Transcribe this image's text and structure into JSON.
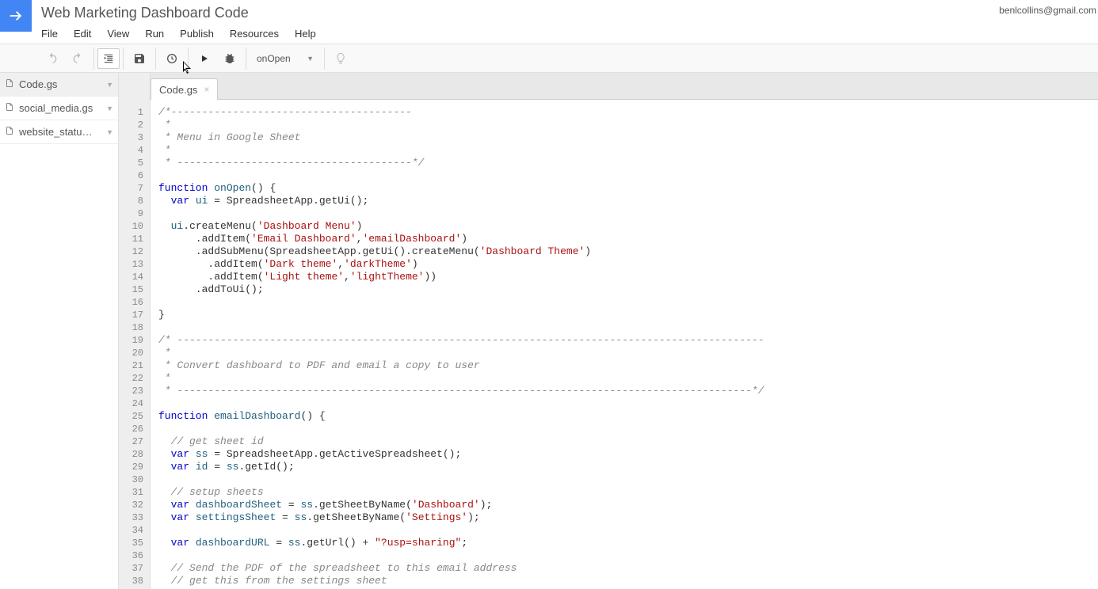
{
  "header": {
    "title": "Web Marketing Dashboard Code",
    "user_email": "benlcollins@gmail.com",
    "menus": [
      "File",
      "Edit",
      "View",
      "Run",
      "Publish",
      "Resources",
      "Help"
    ]
  },
  "toolbar": {
    "function_selected": "onOpen"
  },
  "sidebar": {
    "files": [
      {
        "name": "Code.gs",
        "active": true
      },
      {
        "name": "social_media.gs",
        "active": false
      },
      {
        "name": "website_statu…",
        "active": false
      }
    ]
  },
  "tabs": [
    {
      "label": "Code.gs",
      "active": true
    }
  ],
  "code": {
    "lines": [
      {
        "n": 1,
        "t": [
          [
            "comment",
            "/*---------------------------------------"
          ]
        ]
      },
      {
        "n": 2,
        "t": [
          [
            "comment",
            " *"
          ]
        ]
      },
      {
        "n": 3,
        "t": [
          [
            "comment",
            " * Menu in Google Sheet"
          ]
        ]
      },
      {
        "n": 4,
        "t": [
          [
            "comment",
            " *"
          ]
        ]
      },
      {
        "n": 5,
        "t": [
          [
            "comment",
            " * --------------------------------------*/"
          ]
        ]
      },
      {
        "n": 6,
        "t": []
      },
      {
        "n": 7,
        "t": [
          [
            "kw",
            "function"
          ],
          [
            "plain",
            " "
          ],
          [
            "name",
            "onOpen"
          ],
          [
            "plain",
            "() {"
          ]
        ]
      },
      {
        "n": 8,
        "t": [
          [
            "plain",
            "  "
          ],
          [
            "kw",
            "var"
          ],
          [
            "plain",
            " "
          ],
          [
            "prop",
            "ui"
          ],
          [
            "plain",
            " = SpreadsheetApp.getUi();"
          ]
        ]
      },
      {
        "n": 9,
        "t": []
      },
      {
        "n": 10,
        "t": [
          [
            "plain",
            "  "
          ],
          [
            "prop",
            "ui"
          ],
          [
            "plain",
            ".createMenu("
          ],
          [
            "str",
            "'Dashboard Menu'"
          ],
          [
            "plain",
            ")"
          ]
        ]
      },
      {
        "n": 11,
        "t": [
          [
            "plain",
            "      .addItem("
          ],
          [
            "str",
            "'Email Dashboard'"
          ],
          [
            "plain",
            ","
          ],
          [
            "str",
            "'emailDashboard'"
          ],
          [
            "plain",
            ")"
          ]
        ]
      },
      {
        "n": 12,
        "t": [
          [
            "plain",
            "      .addSubMenu(SpreadsheetApp.getUi().createMenu("
          ],
          [
            "str",
            "'Dashboard Theme'"
          ],
          [
            "plain",
            ")"
          ]
        ]
      },
      {
        "n": 13,
        "t": [
          [
            "plain",
            "        .addItem("
          ],
          [
            "str",
            "'Dark theme'"
          ],
          [
            "plain",
            ","
          ],
          [
            "str",
            "'darkTheme'"
          ],
          [
            "plain",
            ")"
          ]
        ]
      },
      {
        "n": 14,
        "t": [
          [
            "plain",
            "        .addItem("
          ],
          [
            "str",
            "'Light theme'"
          ],
          [
            "plain",
            ","
          ],
          [
            "str",
            "'lightTheme'"
          ],
          [
            "plain",
            "))"
          ]
        ]
      },
      {
        "n": 15,
        "t": [
          [
            "plain",
            "      .addToUi();"
          ]
        ]
      },
      {
        "n": 16,
        "t": []
      },
      {
        "n": 17,
        "t": [
          [
            "plain",
            "}"
          ]
        ]
      },
      {
        "n": 18,
        "t": []
      },
      {
        "n": 19,
        "t": [
          [
            "comment",
            "/* -----------------------------------------------------------------------------------------------"
          ]
        ]
      },
      {
        "n": 20,
        "t": [
          [
            "comment",
            " *"
          ]
        ]
      },
      {
        "n": 21,
        "t": [
          [
            "comment",
            " * Convert dashboard to PDF and email a copy to user"
          ]
        ]
      },
      {
        "n": 22,
        "t": [
          [
            "comment",
            " *"
          ]
        ]
      },
      {
        "n": 23,
        "t": [
          [
            "comment",
            " * ---------------------------------------------------------------------------------------------*/"
          ]
        ]
      },
      {
        "n": 24,
        "t": []
      },
      {
        "n": 25,
        "t": [
          [
            "kw",
            "function"
          ],
          [
            "plain",
            " "
          ],
          [
            "name",
            "emailDashboard"
          ],
          [
            "plain",
            "() {"
          ]
        ]
      },
      {
        "n": 26,
        "t": []
      },
      {
        "n": 27,
        "t": [
          [
            "plain",
            "  "
          ],
          [
            "comment",
            "// get sheet id"
          ]
        ]
      },
      {
        "n": 28,
        "t": [
          [
            "plain",
            "  "
          ],
          [
            "kw",
            "var"
          ],
          [
            "plain",
            " "
          ],
          [
            "prop",
            "ss"
          ],
          [
            "plain",
            " = SpreadsheetApp.getActiveSpreadsheet();"
          ]
        ]
      },
      {
        "n": 29,
        "t": [
          [
            "plain",
            "  "
          ],
          [
            "kw",
            "var"
          ],
          [
            "plain",
            " "
          ],
          [
            "prop",
            "id"
          ],
          [
            "plain",
            " = "
          ],
          [
            "prop",
            "ss"
          ],
          [
            "plain",
            ".getId();"
          ]
        ]
      },
      {
        "n": 30,
        "t": []
      },
      {
        "n": 31,
        "t": [
          [
            "plain",
            "  "
          ],
          [
            "comment",
            "// setup sheets"
          ]
        ]
      },
      {
        "n": 32,
        "t": [
          [
            "plain",
            "  "
          ],
          [
            "kw",
            "var"
          ],
          [
            "plain",
            " "
          ],
          [
            "prop",
            "dashboardSheet"
          ],
          [
            "plain",
            " = "
          ],
          [
            "prop",
            "ss"
          ],
          [
            "plain",
            ".getSheetByName("
          ],
          [
            "str",
            "'Dashboard'"
          ],
          [
            "plain",
            ");"
          ]
        ]
      },
      {
        "n": 33,
        "t": [
          [
            "plain",
            "  "
          ],
          [
            "kw",
            "var"
          ],
          [
            "plain",
            " "
          ],
          [
            "prop",
            "settingsSheet"
          ],
          [
            "plain",
            " = "
          ],
          [
            "prop",
            "ss"
          ],
          [
            "plain",
            ".getSheetByName("
          ],
          [
            "str",
            "'Settings'"
          ],
          [
            "plain",
            ");"
          ]
        ]
      },
      {
        "n": 34,
        "t": []
      },
      {
        "n": 35,
        "t": [
          [
            "plain",
            "  "
          ],
          [
            "kw",
            "var"
          ],
          [
            "plain",
            " "
          ],
          [
            "prop",
            "dashboardURL"
          ],
          [
            "plain",
            " = "
          ],
          [
            "prop",
            "ss"
          ],
          [
            "plain",
            ".getUrl() + "
          ],
          [
            "str",
            "\"?usp=sharing\""
          ],
          [
            "plain",
            ";"
          ]
        ]
      },
      {
        "n": 36,
        "t": []
      },
      {
        "n": 37,
        "t": [
          [
            "plain",
            "  "
          ],
          [
            "comment",
            "// Send the PDF of the spreadsheet to this email address"
          ]
        ]
      },
      {
        "n": 38,
        "t": [
          [
            "plain",
            "  "
          ],
          [
            "comment",
            "// get this from the settings sheet"
          ]
        ]
      }
    ]
  }
}
